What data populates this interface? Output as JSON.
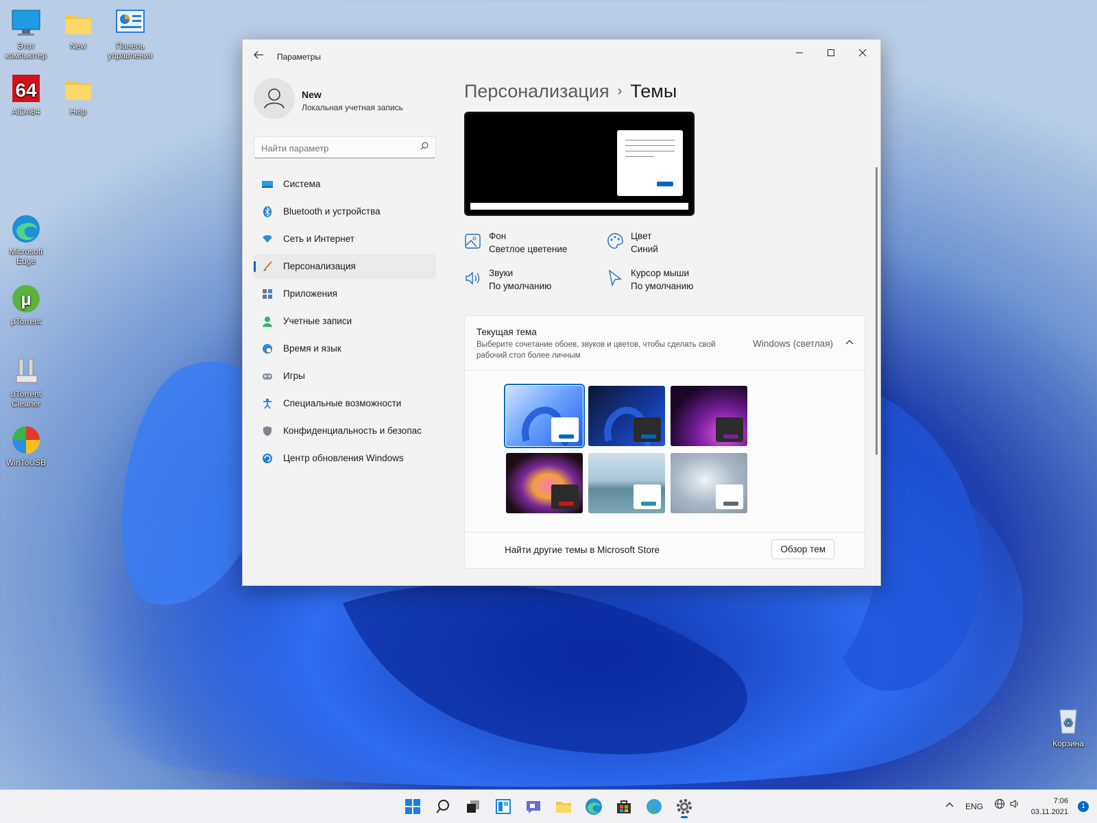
{
  "desktop": {
    "icons": [
      {
        "label": "Этот компьютер"
      },
      {
        "label": "New"
      },
      {
        "label": "Панель управления"
      },
      {
        "label": "AIDA64"
      },
      {
        "label": "Help"
      },
      {
        "label": "Microsoft Edge"
      },
      {
        "label": "µTorrent"
      },
      {
        "label": "uTorrent Cleaner"
      },
      {
        "label": "WinToUSB"
      },
      {
        "label": "Корзина"
      }
    ]
  },
  "window": {
    "title": "Параметры",
    "profile": {
      "name": "New",
      "subtitle": "Локальная учетная запись"
    },
    "search": {
      "placeholder": "Найти параметр"
    },
    "nav": [
      {
        "label": "Система",
        "icon": "system-icon"
      },
      {
        "label": "Bluetooth и устройства",
        "icon": "bluetooth-icon"
      },
      {
        "label": "Сеть и Интернет",
        "icon": "wifi-icon"
      },
      {
        "label": "Персонализация",
        "icon": "brush-icon",
        "active": true
      },
      {
        "label": "Приложения",
        "icon": "apps-icon"
      },
      {
        "label": "Учетные записи",
        "icon": "account-icon"
      },
      {
        "label": "Время и язык",
        "icon": "globe-clock-icon"
      },
      {
        "label": "Игры",
        "icon": "gamepad-icon"
      },
      {
        "label": "Специальные возможности",
        "icon": "accessibility-icon"
      },
      {
        "label": "Конфиденциальность и безопас",
        "icon": "shield-icon"
      },
      {
        "label": "Центр обновления Windows",
        "icon": "update-icon"
      }
    ],
    "breadcrumb": {
      "parent": "Персонализация",
      "separator": "›",
      "current": "Темы"
    },
    "properties": [
      {
        "title": "Фон",
        "value": "Светлое цветение",
        "icon": "picture-icon"
      },
      {
        "title": "Цвет",
        "value": "Синий",
        "icon": "palette-icon"
      },
      {
        "title": "Звуки",
        "value": "По умолчанию",
        "icon": "speaker-icon"
      },
      {
        "title": "Курсор мыши",
        "value": "По умолчанию",
        "icon": "cursor-icon"
      }
    ],
    "current_theme": {
      "title": "Текущая тема",
      "description": "Выберите сочетание обоев, звуков и цветов, чтобы сделать свой рабочий стол более личным",
      "value": "Windows (светлая)",
      "store_text": "Найти другие темы в Microsoft Store",
      "browse_button": "Обзор тем"
    },
    "themes": [
      {
        "name": "windows-light",
        "selected": true,
        "bg": "#7fb5ff",
        "win": "#ffffff",
        "btn": "#0067c0"
      },
      {
        "name": "windows-dark",
        "selected": false,
        "bg": "#0f1f4c",
        "win": "#2b2b2b",
        "btn": "#0067c0"
      },
      {
        "name": "glow",
        "selected": false,
        "bg": "#3a0f4a",
        "win": "#2b2b2b",
        "btn": "#7a1fa0"
      },
      {
        "name": "captured-motion",
        "selected": false,
        "bg": "#20121a",
        "win": "#2b2b2b",
        "btn": "#c8161d"
      },
      {
        "name": "sunrise",
        "selected": false,
        "bg": "#8fb4c4",
        "win": "#ffffff",
        "btn": "#2b8fa8"
      },
      {
        "name": "flow",
        "selected": false,
        "bg": "#b7c3cf",
        "win": "#ffffff",
        "btn": "#5d6770"
      }
    ]
  },
  "taskbar": {
    "apps": [
      "start-icon",
      "search-icon",
      "task-view-icon",
      "widgets-icon",
      "chat-icon",
      "file-explorer-icon",
      "edge-icon",
      "store-icon",
      "globe-app-icon",
      "settings-icon"
    ],
    "language": "ENG",
    "time": "7:06",
    "date": "03.11.2021",
    "notifications": "1"
  },
  "colors": {
    "accent": "#0067c0",
    "window_bg": "#f3f3f3"
  }
}
